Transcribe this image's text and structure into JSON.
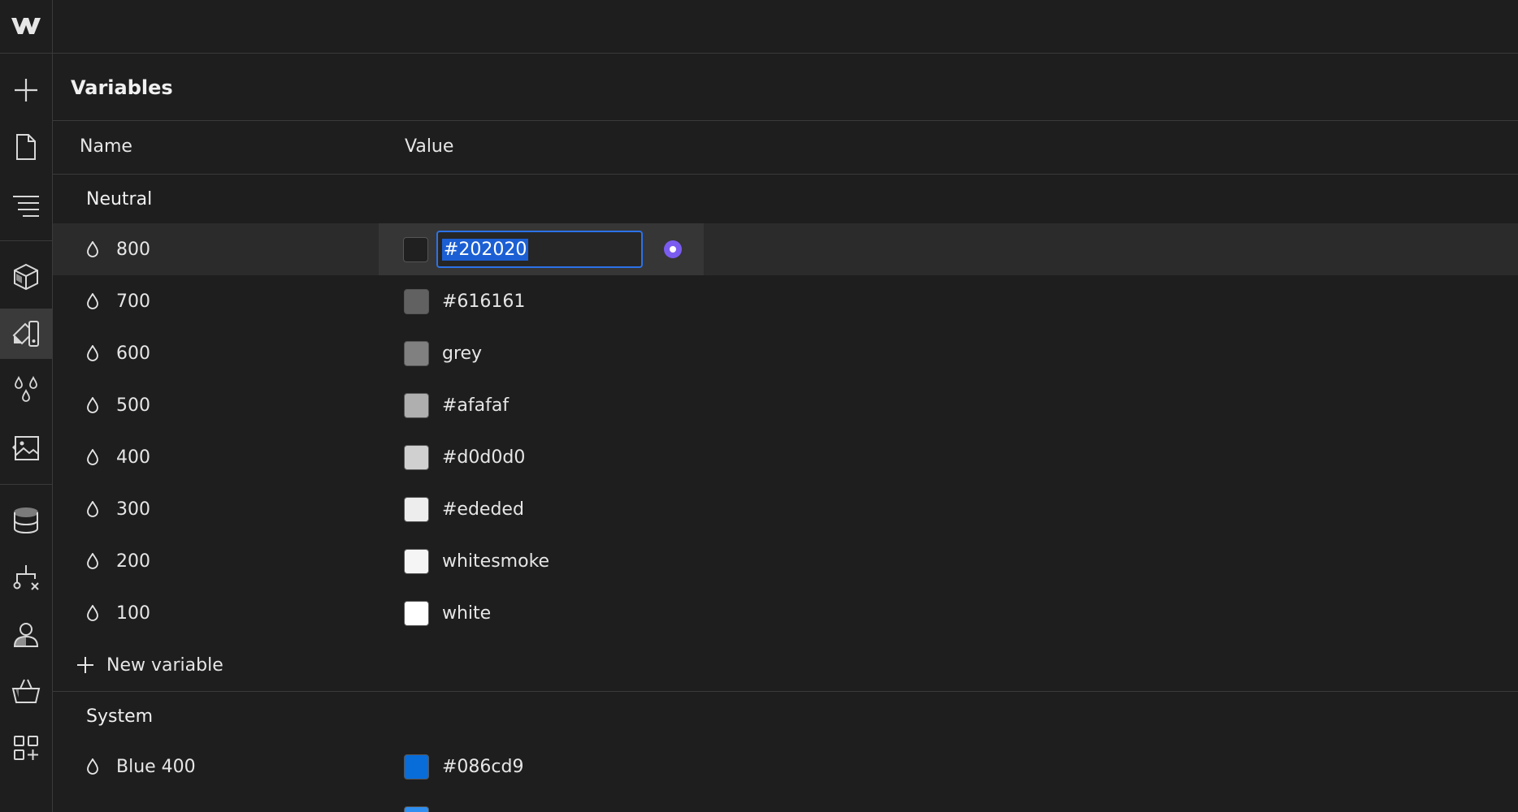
{
  "panel": {
    "title": "Variables"
  },
  "columns": {
    "name": "Name",
    "value": "Value"
  },
  "groups": [
    {
      "title": "Neutral",
      "rows": [
        {
          "name": "800",
          "value": "#202020",
          "color": "#202020",
          "selected": true
        },
        {
          "name": "700",
          "value": "#616161",
          "color": "#616161"
        },
        {
          "name": "600",
          "value": "grey",
          "color": "#808080"
        },
        {
          "name": "500",
          "value": "#afafaf",
          "color": "#afafaf"
        },
        {
          "name": "400",
          "value": "#d0d0d0",
          "color": "#d0d0d0"
        },
        {
          "name": "300",
          "value": "#ededed",
          "color": "#ededed"
        },
        {
          "name": "200",
          "value": "whitesmoke",
          "color": "#f5f5f5"
        },
        {
          "name": "100",
          "value": "white",
          "color": "#ffffff"
        }
      ],
      "new_variable_label": "New variable"
    },
    {
      "title": "System",
      "rows": [
        {
          "name": "Blue 400",
          "value": "#086cd9",
          "color": "#086cd9"
        }
      ]
    }
  ],
  "rail": {
    "items": [
      "webflow-logo-icon",
      "add-icon",
      "page-icon",
      "navigator-icon",
      "components-icon",
      "style-selector-icon",
      "variables-icon",
      "assets-icon",
      "cms-icon",
      "logic-icon",
      "users-icon",
      "ecommerce-icon",
      "apps-icon"
    ],
    "active": "style-selector-icon"
  },
  "colors": {
    "background": "#1e1e1e",
    "border": "#3a3a3a",
    "accent": "#2c72e8",
    "bind": "#7b5cf0"
  }
}
